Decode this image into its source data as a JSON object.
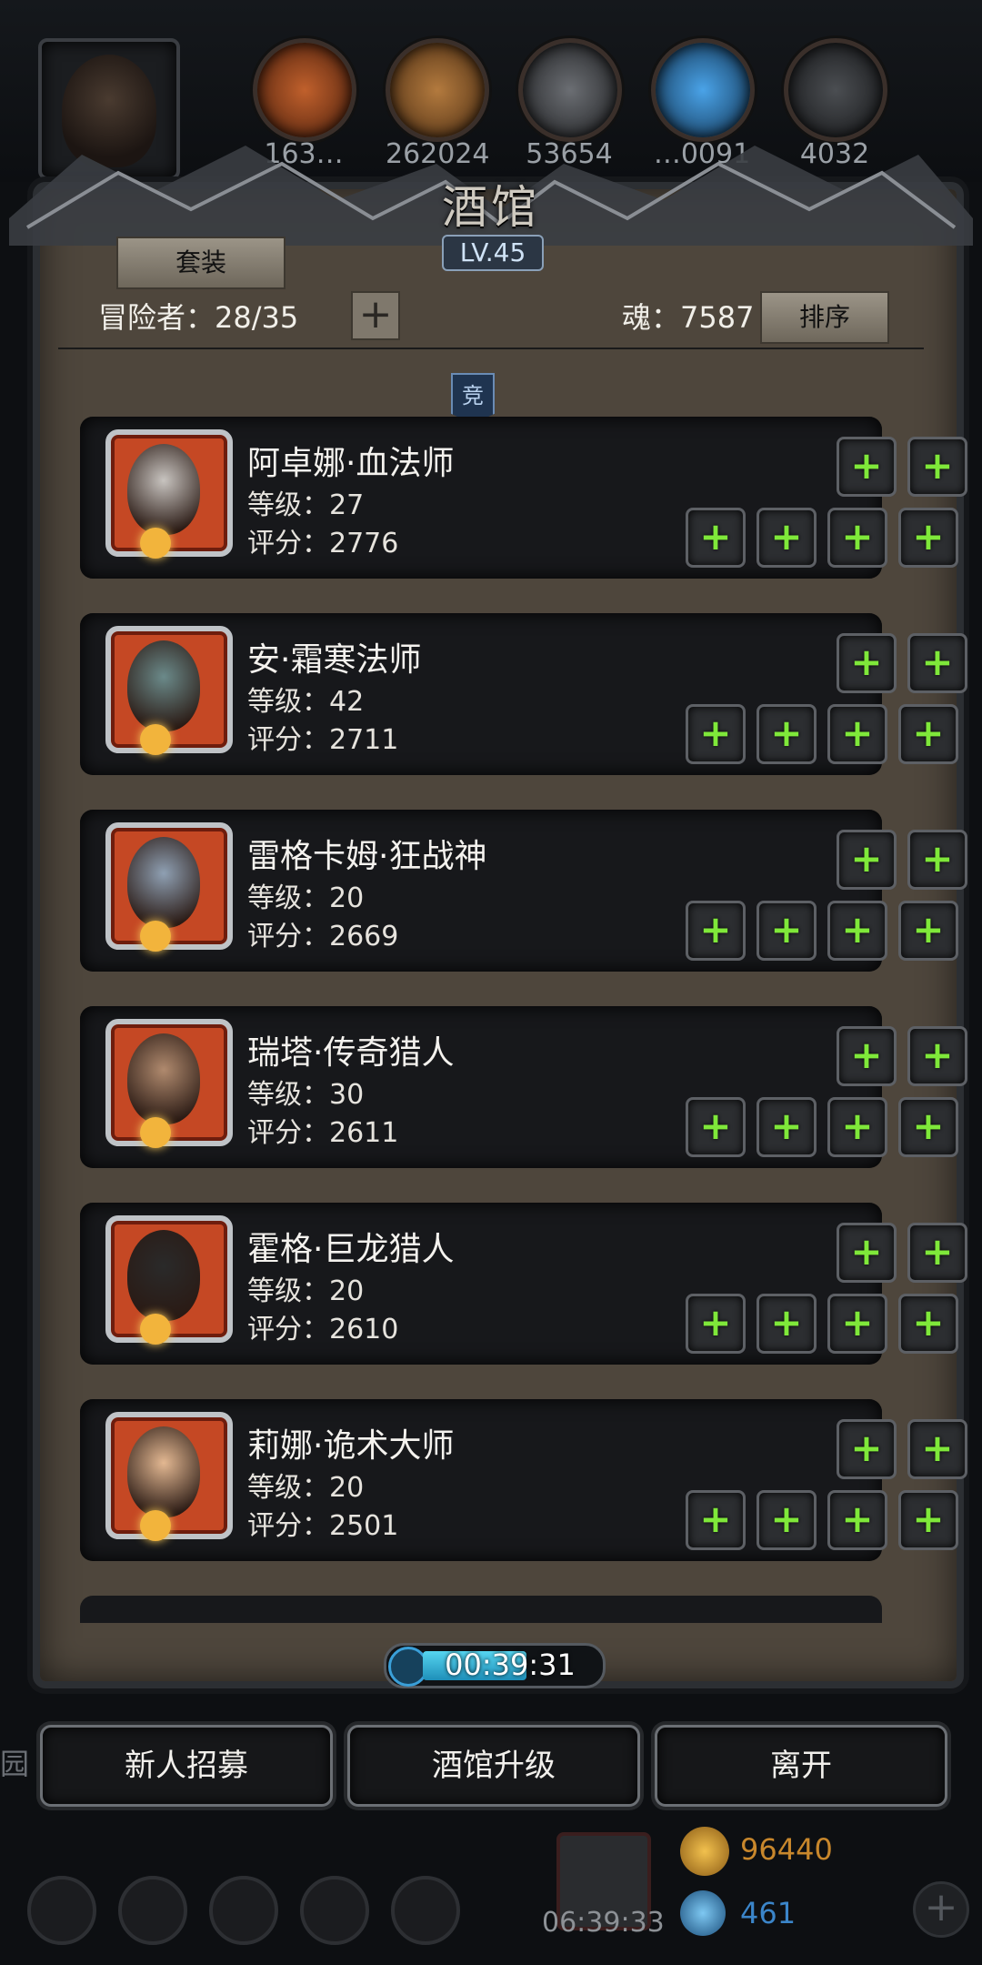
{
  "resources": [
    {
      "icon": "meat-resource-icon",
      "value": "163…",
      "color": "#9c4a22"
    },
    {
      "icon": "wood-resource-icon",
      "value": "262024",
      "color": "#8a5a2c"
    },
    {
      "icon": "iron-resource-icon",
      "value": "53654",
      "color": "#3d3f43"
    },
    {
      "icon": "crystal-resource-icon",
      "value": "…0091",
      "color": "#2a72b5"
    },
    {
      "icon": "ore-resource-icon",
      "value": "4032",
      "color": "#2b2d30"
    }
  ],
  "panel": {
    "title": "酒馆",
    "level": "LV.45",
    "set_button": "套装",
    "adventurers": "冒险者：28/35",
    "add_symbol": "+",
    "soul": "魂：7587",
    "sort_button": "排序",
    "divider_badge": "竞"
  },
  "heroes": [
    {
      "name": "阿卓娜·血法师",
      "level": "等级：27",
      "score": "评分：2776",
      "face": "#c8c4c0"
    },
    {
      "name": "安·霜寒法师",
      "level": "等级：42",
      "score": "评分：2711",
      "face": "#6b8a8a"
    },
    {
      "name": "雷格卡姆·狂战神",
      "level": "等级：20",
      "score": "评分：2669",
      "face": "#8fa0b3"
    },
    {
      "name": "瑞塔·传奇猎人",
      "level": "等级：30",
      "score": "评分：2611",
      "face": "#b08a6e"
    },
    {
      "name": "霍格·巨龙猎人",
      "level": "等级：20",
      "score": "评分：2610",
      "face": "#2a2a2a"
    },
    {
      "name": "莉娜·诡术大师",
      "level": "等级：20",
      "score": "评分：2501",
      "face": "#e3b892"
    }
  ],
  "timer": {
    "value": "00:39:31",
    "progress": 0.6
  },
  "buttons": {
    "recruit": "新人招募",
    "upgrade": "酒馆升级",
    "leave": "离开"
  },
  "hud": {
    "side_text": "园",
    "gift_timer": "06:39:33",
    "gold": "96440",
    "gems": "461",
    "add_symbol": "+"
  },
  "colors": {
    "accent_green": "#7fe83a",
    "gold": "#c8872c",
    "gem": "#3b85c9"
  }
}
